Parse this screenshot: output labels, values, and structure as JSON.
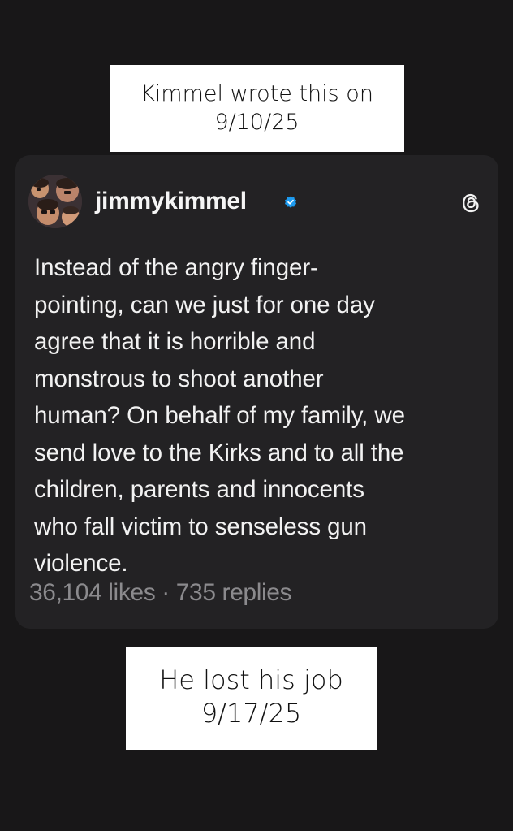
{
  "top_caption": {
    "line1": "Kimmel wrote this on",
    "line2": "9/10/25"
  },
  "post": {
    "username": "jimmykimmel",
    "verified_icon": "verified-badge-icon",
    "platform_icon": "threads-icon",
    "text_lines": [
      "Instead of the angry finger-",
      "pointing, can we just for one day",
      "agree that it is horrible and",
      "monstrous to shoot another",
      "human? On behalf of my family, we",
      "send love to the Kirks and to all the",
      "children, parents and innocents",
      "who fall victim to senseless gun",
      "violence."
    ],
    "stats": "36,104 likes · 735 replies"
  },
  "bottom_caption": {
    "line1": "He lost his job",
    "line2": "9/17/25"
  },
  "colors": {
    "background": "#181718",
    "card": "#232224",
    "verified": "#1d9bf0"
  }
}
